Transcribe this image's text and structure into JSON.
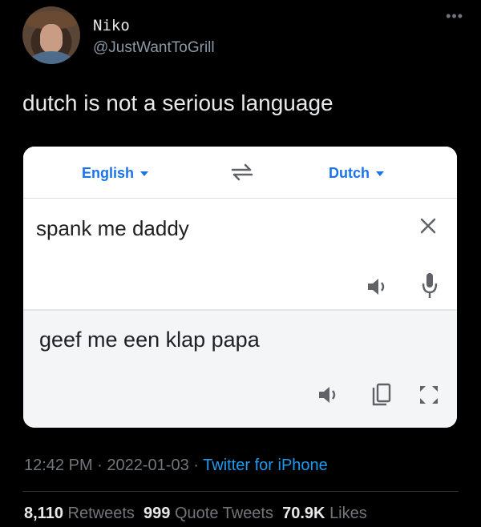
{
  "author": {
    "name": "Niko",
    "handle": "@JustWantToGrill",
    "avatar_icon": "profile-photo"
  },
  "tweet": {
    "text": "dutch is not a serious language",
    "time": "12:42 PM",
    "date": "2022-01-03",
    "separator": "·",
    "source": "Twitter for iPhone"
  },
  "translator": {
    "source_language": "English",
    "target_language": "Dutch",
    "source_text": "spank me daddy",
    "translated_text": "geef me een klap papa",
    "icons": [
      "swap-arrows-icon",
      "close-icon",
      "speaker-icon",
      "microphone-icon",
      "copy-icon",
      "expand-icon"
    ],
    "accent_color": "#1a73e8"
  },
  "stats": {
    "retweets_count": "8,110",
    "retweets_label": "Retweets",
    "quotes_count": "999",
    "quotes_label": "Quote Tweets",
    "likes_count": "70.9K",
    "likes_label": "Likes"
  },
  "colors": {
    "background": "#000000",
    "link": "#1d9bf0",
    "muted": "#71767b"
  }
}
